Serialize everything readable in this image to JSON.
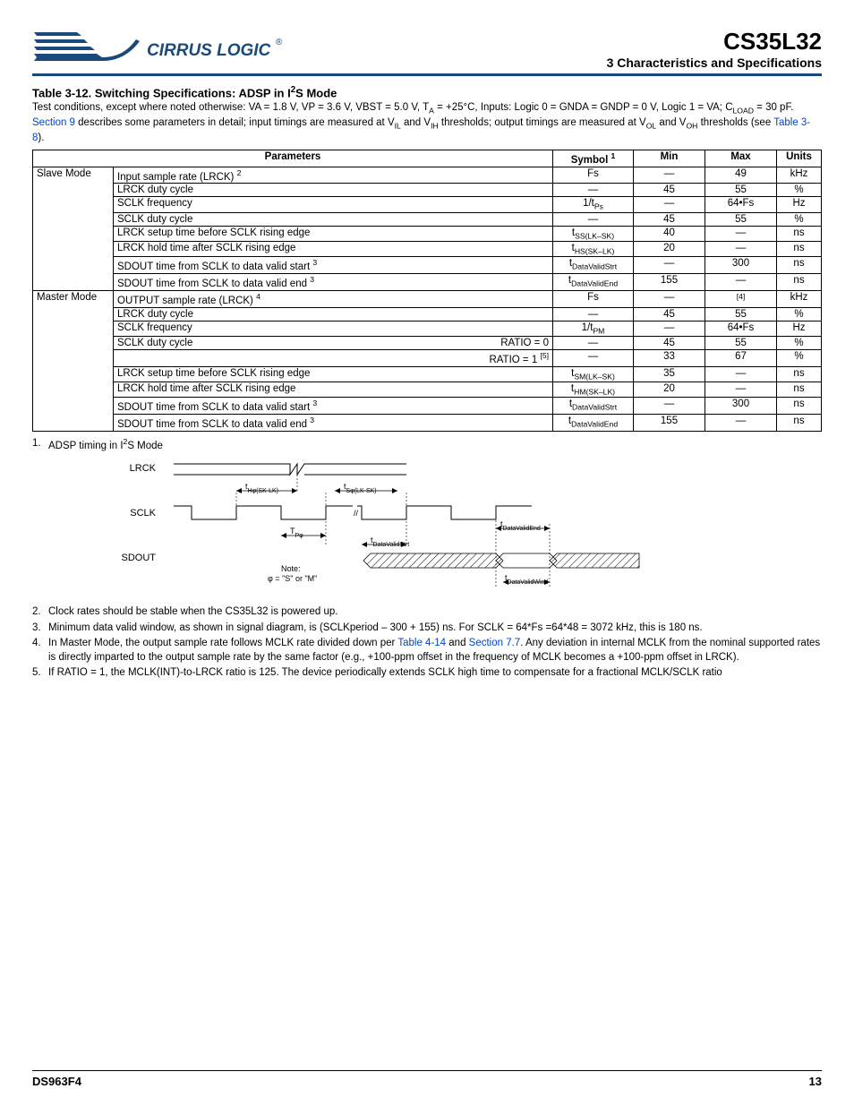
{
  "header": {
    "brand": "CIRRUS LOGIC",
    "part": "CS35L32",
    "section": "3 Characteristics and Specifications"
  },
  "table": {
    "caption_prefix": "Table 3-12. Switching Specifications: ADSP in I",
    "caption_suffix": "S Mode",
    "caption_sup": "2",
    "test_conditions_1": "Test conditions, except where noted otherwise: VA = 1.8 V, VP = 3.6 V, VBST = 5.0 V, T",
    "test_conditions_1b": " = +25°C, Inputs: Logic 0 = GNDA = GNDP = 0 V, Logic 1 = VA; C",
    "test_conditions_2": " = 30 pF. ",
    "test_conditions_link1": "Section 9",
    "test_conditions_3": " describes some parameters in detail; input timings are measured at V",
    "test_conditions_4": " and V",
    "test_conditions_5": " thresholds; output timings are measured at V",
    "test_conditions_6": " and V",
    "test_conditions_7": " thresholds (see ",
    "test_conditions_link2": "Table 3-8",
    "test_conditions_8": ").",
    "sub_TA": "A",
    "sub_CLOAD": "LOAD",
    "sub_VIL": "IL",
    "sub_VIH": "IH",
    "sub_VOL": "OL",
    "sub_VOH": "OH",
    "headers": {
      "params": "Parameters",
      "symbol": "Symbol ",
      "symbol_sup": "1",
      "min": "Min",
      "max": "Max",
      "units": "Units"
    },
    "modes": {
      "slave": "Slave Mode",
      "master": "Master Mode"
    },
    "rows_slave": [
      {
        "param": "Input sample rate (LRCK) ",
        "sup": "2",
        "sym": "Fs",
        "min": "—",
        "max": "49",
        "units": "kHz"
      },
      {
        "param": "LRCK duty cycle",
        "sym": "—",
        "min": "45",
        "max": "55",
        "units": "%"
      },
      {
        "param": "SCLK frequency",
        "sym": "1/t",
        "symsub": "Ps",
        "min": "—",
        "max": "64•Fs",
        "units": "Hz"
      },
      {
        "param": "SCLK duty cycle",
        "sym": "—",
        "min": "45",
        "max": "55",
        "units": "%"
      },
      {
        "param": "LRCK setup time before SCLK rising edge",
        "sym": "t",
        "symsub": "SS(LK–SK)",
        "min": "40",
        "max": "—",
        "units": "ns"
      },
      {
        "param": "LRCK hold time after SCLK rising edge",
        "sym": "t",
        "symsub": "HS(SK–LK)",
        "min": "20",
        "max": "—",
        "units": "ns"
      },
      {
        "param": "SDOUT time from SCLK to data valid start ",
        "sup": "3",
        "sym": "t",
        "symsub": "DataValidStrt",
        "min": "—",
        "max": "300",
        "units": "ns"
      },
      {
        "param": "SDOUT time from SCLK to data valid end ",
        "sup": "3",
        "sym": "t",
        "symsub": "DataValidEnd",
        "min": "155",
        "max": "—",
        "units": "ns"
      }
    ],
    "rows_master": [
      {
        "param": "OUTPUT sample rate (LRCK) ",
        "sup": "4",
        "sym": "Fs",
        "min": "—",
        "max": "[4]",
        "units": "kHz",
        "maxsup": true
      },
      {
        "param": "LRCK duty cycle",
        "sym": "—",
        "min": "45",
        "max": "55",
        "units": "%"
      },
      {
        "param": "SCLK frequency",
        "sym": "1/t",
        "symsub": "PM",
        "min": "—",
        "max": "64•Fs",
        "units": "Hz"
      },
      {
        "param": "SCLK duty cycle",
        "right": "RATIO = 0",
        "sym": "—",
        "min": "45",
        "max": "55",
        "units": "%"
      },
      {
        "param": "",
        "right": "RATIO = 1 ",
        "rightsup": "[5]",
        "sym": "—",
        "min": "33",
        "max": "67",
        "units": "%",
        "noborder": true
      },
      {
        "param": "LRCK setup time before SCLK rising edge",
        "sym": "t",
        "symsub": "SM(LK–SK)",
        "min": "35",
        "max": "—",
        "units": "ns"
      },
      {
        "param": "LRCK hold time after SCLK rising edge",
        "sym": "t",
        "symsub": "HM(SK–LK)",
        "min": "20",
        "max": "—",
        "units": "ns"
      },
      {
        "param": "SDOUT time from SCLK to data valid start ",
        "sup": "3",
        "sym": "t",
        "symsub": "DataValidStrt",
        "min": "—",
        "max": "300",
        "units": "ns"
      },
      {
        "param": "SDOUT time from SCLK to data valid end ",
        "sup": "3",
        "sym": "t",
        "symsub": "DataValidEnd",
        "min": "155",
        "max": "—",
        "units": "ns"
      }
    ]
  },
  "diagram": {
    "lrck": "LRCK",
    "sclk": "SCLK",
    "sdout": "SDOUT",
    "tH": "t",
    "tH_sub": "Hφ(SK-LK)",
    "tS": "t",
    "tS_sub": "Sφ(LK-SK)",
    "tP": "T",
    "tP_sub": "Pφ",
    "tDVS": "t",
    "tDVS_sub": "DataValidStrt",
    "tDVE": "t",
    "tDVE_sub": "DataValidEnd",
    "tDVW": "t",
    "tDVW_sub": "DataValidWind",
    "note": "Note:",
    "note2": "φ = \"S\" or \"M\""
  },
  "footnotes": {
    "f1_a": "ADSP timing in I",
    "f1_sup": "2",
    "f1_b": "S Mode",
    "f2": "Clock rates should be stable when the CS35L32 is powered up.",
    "f3": "Minimum data valid window, as shown in signal diagram, is (SCLKperiod – 300 + 155) ns. For SCLK = 64*Fs =64*48 = 3072 kHz, this is 180 ns.",
    "f4_a": "In Master Mode, the output sample rate follows MCLK rate divided down per ",
    "f4_link1": "Table 4-14",
    "f4_b": " and ",
    "f4_link2": "Section 7.7",
    "f4_c": ". Any deviation in internal MCLK from the nominal supported rates is directly imparted to the output sample rate by the same factor (e.g., +100-ppm offset in the frequency of MCLK becomes a +100-ppm offset in LRCK).",
    "f5": "If RATIO = 1, the MCLK(INT)-to-LRCK ratio is 125. The device periodically extends SCLK high time to compensate for a fractional MCLK/SCLK ratio"
  },
  "footer": {
    "left": "DS963F4",
    "right": "13"
  }
}
